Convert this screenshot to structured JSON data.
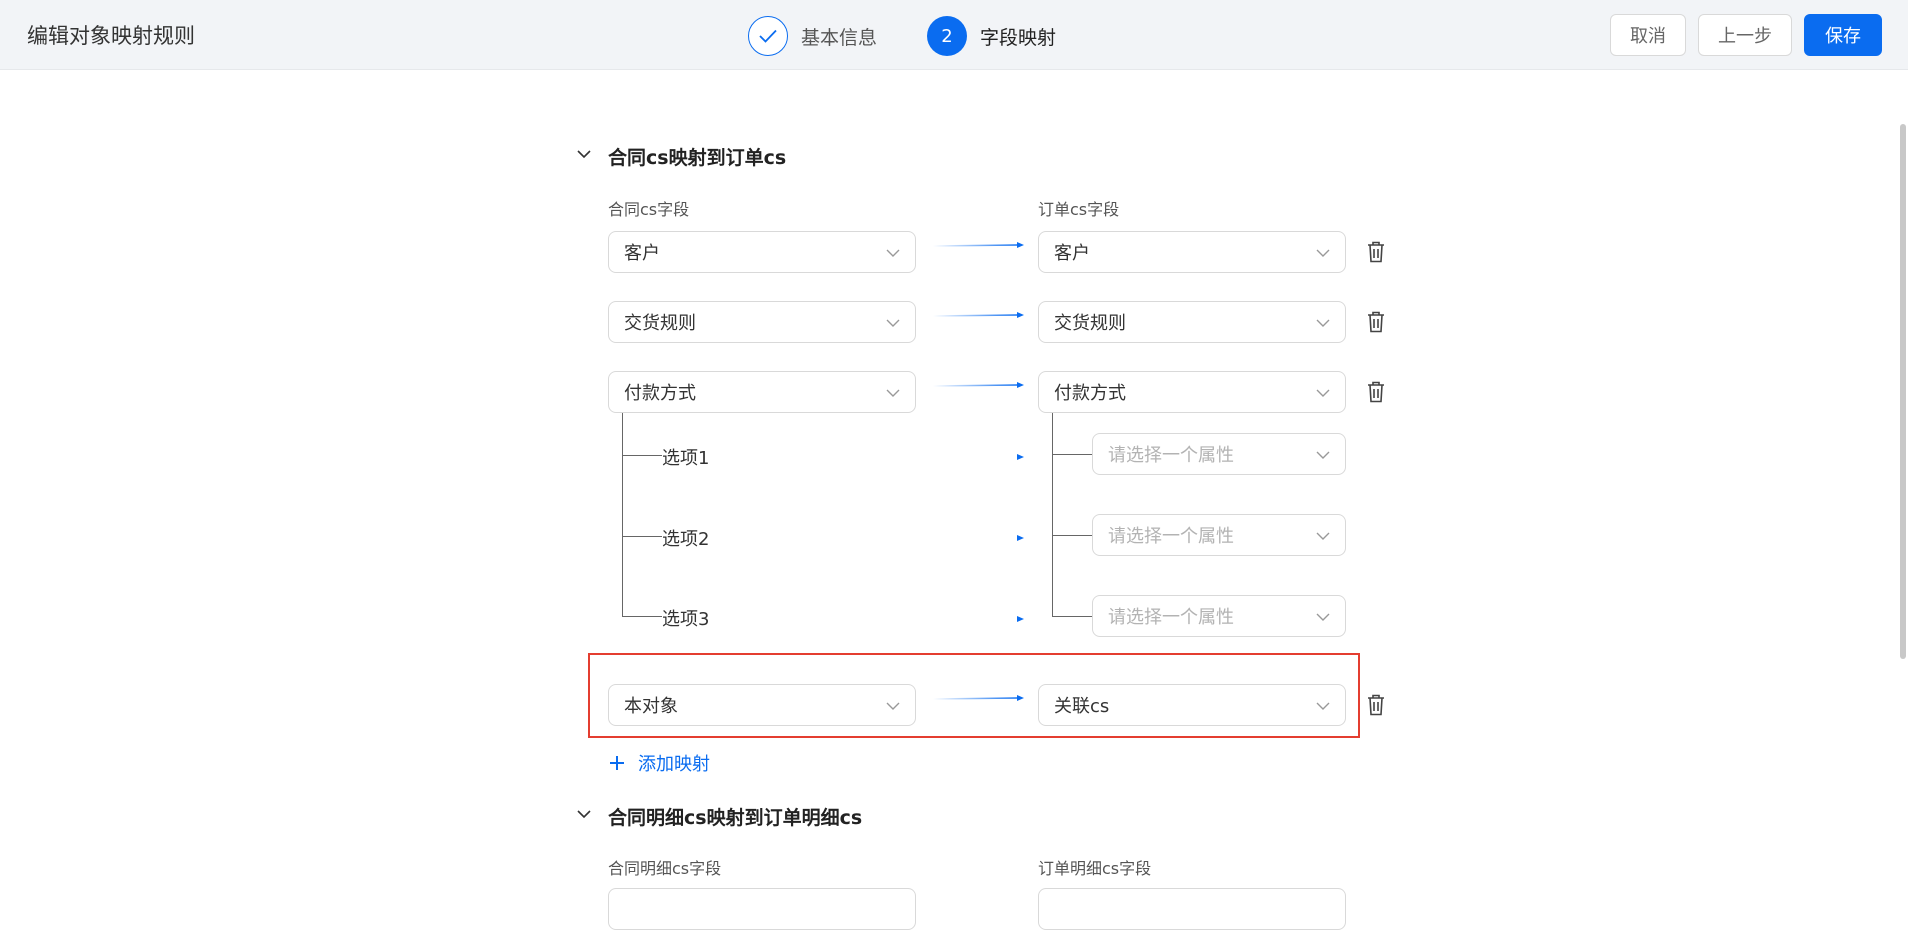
{
  "header": {
    "title": "编辑对象映射规则",
    "steps": [
      {
        "label": "基本信息",
        "status": "done"
      },
      {
        "number": "2",
        "label": "字段映射",
        "status": "active"
      }
    ],
    "buttons": {
      "cancel": "取消",
      "prev": "上一步",
      "save": "保存"
    }
  },
  "sections": [
    {
      "title": "合同cs映射到订单cs",
      "source_column": "合同cs字段",
      "target_column": "订单cs字段",
      "rows": [
        {
          "source": "客户",
          "target": "客户"
        },
        {
          "source": "交货规则",
          "target": "交货规则"
        },
        {
          "source": "付款方式",
          "target": "付款方式",
          "options": [
            {
              "label": "选项1",
              "target_placeholder": "请选择一个属性"
            },
            {
              "label": "选项2",
              "target_placeholder": "请选择一个属性"
            },
            {
              "label": "选项3",
              "target_placeholder": "请选择一个属性"
            }
          ]
        },
        {
          "source": "本对象",
          "target": "关联cs"
        }
      ],
      "add_label": "添加映射"
    },
    {
      "title": "合同明细cs映射到订单明细cs",
      "source_column": "合同明细cs字段",
      "target_column": "订单明细cs字段"
    }
  ],
  "colors": {
    "primary": "#0a6cf0",
    "highlight": "#e43d30",
    "header_bg": "#f2f4f7"
  }
}
